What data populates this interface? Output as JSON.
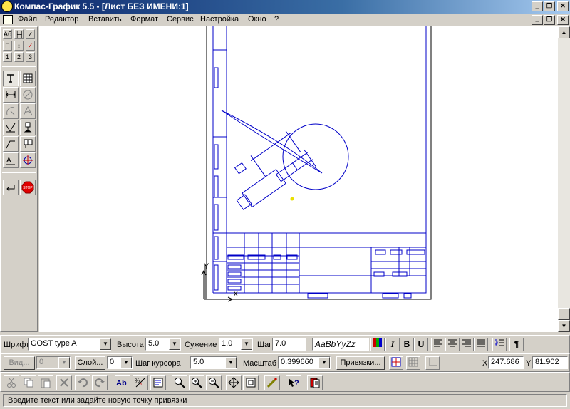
{
  "window": {
    "title": "Компас-График 5.5 - [Лист БЕЗ ИМЕНИ:1]",
    "controls": [
      "_",
      "❐",
      "✕"
    ]
  },
  "menu": {
    "items": [
      "Файл",
      "Редактор",
      "Вставить",
      "Формат",
      "Сервис",
      "Настройка",
      "Окно",
      "?"
    ]
  },
  "left_toolbar": {
    "mini_row1": [
      "Аб",
      "├┤",
      "✓"
    ],
    "mini_row2": [
      "П",
      "↕",
      "✓"
    ],
    "mini_row3": [
      "1",
      "2",
      "3"
    ]
  },
  "text_props": {
    "font_label": "Шрифт",
    "font_value": "GOST type A",
    "height_label": "Высота",
    "height_value": "5.0",
    "narrow_label": "Сужение",
    "narrow_value": "1.0",
    "step_label": "Шаг",
    "step_value": "7.0",
    "sample_text": "AaBbYyZz",
    "italic": "I",
    "bold": "B",
    "underline": "U",
    "paragraph": "¶"
  },
  "view_props": {
    "view_label": "Вид...",
    "view_value": "0",
    "layer_label": "Слой...",
    "layer_value": "0",
    "cursor_step_label": "Шаг курсора",
    "cursor_step_value": "5.0",
    "scale_label": "Масштаб",
    "scale_value": "0.399660",
    "snaps_label": "Привязки...",
    "x_label": "X",
    "x_value": "247.686",
    "y_label": "Y",
    "y_value": "81.902"
  },
  "canvas": {
    "axis_y": "Y",
    "axis_x": "X"
  },
  "status": {
    "message": "Введите текст или задайте новую точку привязки"
  },
  "colors": {
    "drawing": "#0000c8",
    "titlebar_start": "#0a246a",
    "titlebar_end": "#a6caf0"
  }
}
